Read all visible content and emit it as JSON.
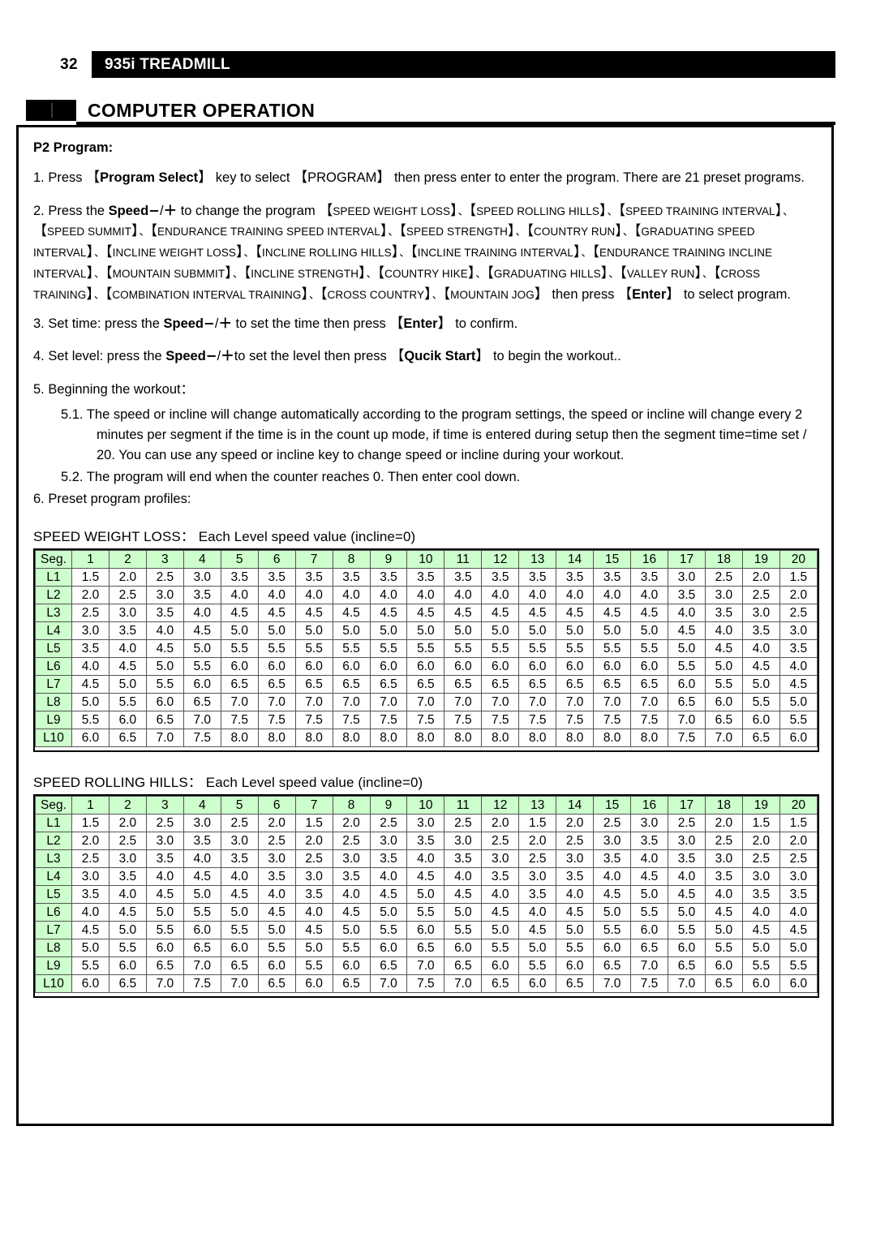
{
  "header": {
    "page_number": "32",
    "title": "935i TREADMILL"
  },
  "section": {
    "title": "COMPUTER OPERATION"
  },
  "content": {
    "lead": "P2 Program:",
    "step1": {
      "prefix": "1. Press",
      "key1": "Program Select",
      "mid1": "key to select",
      "key2": "PROGRAM",
      "tail": "then press enter to enter the program. There are 21 preset programs."
    },
    "step2": {
      "prefix": "2. Press the",
      "speed_label": "Speed",
      "minus": "−",
      "slash": "/",
      "plus": "＋",
      "mid": "to change the program",
      "programs": [
        "SPEED WEIGHT LOSS",
        "SPEED ROLLING HILLS",
        "SPEED TRAINING INTERVAL",
        "SPEED SUMMIT",
        "ENDURANCE TRAINING SPEED INTERVAL",
        "SPEED STRENGTH",
        "COUNTRY RUN",
        "GRADUATING SPEED INTERVAL",
        "INCLINE WEIGHT LOSS",
        "INCLINE ROLLING HILLS",
        "INCLINE TRAINING INTERVAL",
        "ENDURANCE TRAINING INCLINE INTERVAL",
        "MOUNTAIN SUBMMIT",
        "INCLINE STRENGTH",
        "COUNTRY HIKE",
        "GRADUATING HILLS",
        "VALLEY RUN",
        "CROSS TRAINING",
        "COMBINATION INTERVAL TRAINING",
        "CROSS COUNTRY",
        "MOUNTAIN JOG"
      ],
      "then_press": "then press",
      "enter_key": "Enter",
      "tail": "to select program."
    },
    "step3": {
      "prefix": "3. Set time: press the",
      "speed_label": "Speed",
      "mid": "to set the time then press",
      "enter_key": "Enter",
      "tail": "to confirm."
    },
    "step4": {
      "prefix": "4. Set level: press the",
      "speed_label": "Speed",
      "mid": "to set the level then press",
      "quick_key": "Qucik Start",
      "tail": "to begin the workout.."
    },
    "step5": {
      "heading": "5. Beginning the workout：",
      "sub1": "5.1. The speed or incline will change automatically according to the program settings, the speed or incline will change every 2 minutes per segment if the time is in the count up mode, if time is entered during setup then the segment time=time set / 20. You can use any speed or incline key to change speed or incline during your workout.",
      "sub2": "5.2. The program will end when the counter reaches 0. Then enter cool down."
    },
    "step6": "6. Preset program profiles:"
  },
  "tables": [
    {
      "caption": "SPEED WEIGHT LOSS： Each Level speed value (incline=0)",
      "corner": "Seg.",
      "segments": [
        "1",
        "2",
        "3",
        "4",
        "5",
        "6",
        "7",
        "8",
        "9",
        "10",
        "11",
        "12",
        "13",
        "14",
        "15",
        "16",
        "17",
        "18",
        "19",
        "20"
      ],
      "levels": [
        "L1",
        "L2",
        "L3",
        "L4",
        "L5",
        "L6",
        "L7",
        "L8",
        "L9",
        "L10"
      ],
      "rows": [
        [
          "1.5",
          "2.0",
          "2.5",
          "3.0",
          "3.5",
          "3.5",
          "3.5",
          "3.5",
          "3.5",
          "3.5",
          "3.5",
          "3.5",
          "3.5",
          "3.5",
          "3.5",
          "3.5",
          "3.0",
          "2.5",
          "2.0",
          "1.5"
        ],
        [
          "2.0",
          "2.5",
          "3.0",
          "3.5",
          "4.0",
          "4.0",
          "4.0",
          "4.0",
          "4.0",
          "4.0",
          "4.0",
          "4.0",
          "4.0",
          "4.0",
          "4.0",
          "4.0",
          "3.5",
          "3.0",
          "2.5",
          "2.0"
        ],
        [
          "2.5",
          "3.0",
          "3.5",
          "4.0",
          "4.5",
          "4.5",
          "4.5",
          "4.5",
          "4.5",
          "4.5",
          "4.5",
          "4.5",
          "4.5",
          "4.5",
          "4.5",
          "4.5",
          "4.0",
          "3.5",
          "3.0",
          "2.5"
        ],
        [
          "3.0",
          "3.5",
          "4.0",
          "4.5",
          "5.0",
          "5.0",
          "5.0",
          "5.0",
          "5.0",
          "5.0",
          "5.0",
          "5.0",
          "5.0",
          "5.0",
          "5.0",
          "5.0",
          "4.5",
          "4.0",
          "3.5",
          "3.0"
        ],
        [
          "3.5",
          "4.0",
          "4.5",
          "5.0",
          "5.5",
          "5.5",
          "5.5",
          "5.5",
          "5.5",
          "5.5",
          "5.5",
          "5.5",
          "5.5",
          "5.5",
          "5.5",
          "5.5",
          "5.0",
          "4.5",
          "4.0",
          "3.5"
        ],
        [
          "4.0",
          "4.5",
          "5.0",
          "5.5",
          "6.0",
          "6.0",
          "6.0",
          "6.0",
          "6.0",
          "6.0",
          "6.0",
          "6.0",
          "6.0",
          "6.0",
          "6.0",
          "6.0",
          "5.5",
          "5.0",
          "4.5",
          "4.0"
        ],
        [
          "4.5",
          "5.0",
          "5.5",
          "6.0",
          "6.5",
          "6.5",
          "6.5",
          "6.5",
          "6.5",
          "6.5",
          "6.5",
          "6.5",
          "6.5",
          "6.5",
          "6.5",
          "6.5",
          "6.0",
          "5.5",
          "5.0",
          "4.5"
        ],
        [
          "5.0",
          "5.5",
          "6.0",
          "6.5",
          "7.0",
          "7.0",
          "7.0",
          "7.0",
          "7.0",
          "7.0",
          "7.0",
          "7.0",
          "7.0",
          "7.0",
          "7.0",
          "7.0",
          "6.5",
          "6.0",
          "5.5",
          "5.0"
        ],
        [
          "5.5",
          "6.0",
          "6.5",
          "7.0",
          "7.5",
          "7.5",
          "7.5",
          "7.5",
          "7.5",
          "7.5",
          "7.5",
          "7.5",
          "7.5",
          "7.5",
          "7.5",
          "7.5",
          "7.0",
          "6.5",
          "6.0",
          "5.5"
        ],
        [
          "6.0",
          "6.5",
          "7.0",
          "7.5",
          "8.0",
          "8.0",
          "8.0",
          "8.0",
          "8.0",
          "8.0",
          "8.0",
          "8.0",
          "8.0",
          "8.0",
          "8.0",
          "8.0",
          "7.5",
          "7.0",
          "6.5",
          "6.0"
        ]
      ]
    },
    {
      "caption": "SPEED ROLLING HILLS： Each Level speed value (incline=0)",
      "corner": "Seg.",
      "segments": [
        "1",
        "2",
        "3",
        "4",
        "5",
        "6",
        "7",
        "8",
        "9",
        "10",
        "11",
        "12",
        "13",
        "14",
        "15",
        "16",
        "17",
        "18",
        "19",
        "20"
      ],
      "levels": [
        "L1",
        "L2",
        "L3",
        "L4",
        "L5",
        "L6",
        "L7",
        "L8",
        "L9",
        "L10"
      ],
      "rows": [
        [
          "1.5",
          "2.0",
          "2.5",
          "3.0",
          "2.5",
          "2.0",
          "1.5",
          "2.0",
          "2.5",
          "3.0",
          "2.5",
          "2.0",
          "1.5",
          "2.0",
          "2.5",
          "3.0",
          "2.5",
          "2.0",
          "1.5",
          "1.5"
        ],
        [
          "2.0",
          "2.5",
          "3.0",
          "3.5",
          "3.0",
          "2.5",
          "2.0",
          "2.5",
          "3.0",
          "3.5",
          "3.0",
          "2.5",
          "2.0",
          "2.5",
          "3.0",
          "3.5",
          "3.0",
          "2.5",
          "2.0",
          "2.0"
        ],
        [
          "2.5",
          "3.0",
          "3.5",
          "4.0",
          "3.5",
          "3.0",
          "2.5",
          "3.0",
          "3.5",
          "4.0",
          "3.5",
          "3.0",
          "2.5",
          "3.0",
          "3.5",
          "4.0",
          "3.5",
          "3.0",
          "2.5",
          "2.5"
        ],
        [
          "3.0",
          "3.5",
          "4.0",
          "4.5",
          "4.0",
          "3.5",
          "3.0",
          "3.5",
          "4.0",
          "4.5",
          "4.0",
          "3.5",
          "3.0",
          "3.5",
          "4.0",
          "4.5",
          "4.0",
          "3.5",
          "3.0",
          "3.0"
        ],
        [
          "3.5",
          "4.0",
          "4.5",
          "5.0",
          "4.5",
          "4.0",
          "3.5",
          "4.0",
          "4.5",
          "5.0",
          "4.5",
          "4.0",
          "3.5",
          "4.0",
          "4.5",
          "5.0",
          "4.5",
          "4.0",
          "3.5",
          "3.5"
        ],
        [
          "4.0",
          "4.5",
          "5.0",
          "5.5",
          "5.0",
          "4.5",
          "4.0",
          "4.5",
          "5.0",
          "5.5",
          "5.0",
          "4.5",
          "4.0",
          "4.5",
          "5.0",
          "5.5",
          "5.0",
          "4.5",
          "4.0",
          "4.0"
        ],
        [
          "4.5",
          "5.0",
          "5.5",
          "6.0",
          "5.5",
          "5.0",
          "4.5",
          "5.0",
          "5.5",
          "6.0",
          "5.5",
          "5.0",
          "4.5",
          "5.0",
          "5.5",
          "6.0",
          "5.5",
          "5.0",
          "4.5",
          "4.5"
        ],
        [
          "5.0",
          "5.5",
          "6.0",
          "6.5",
          "6.0",
          "5.5",
          "5.0",
          "5.5",
          "6.0",
          "6.5",
          "6.0",
          "5.5",
          "5.0",
          "5.5",
          "6.0",
          "6.5",
          "6.0",
          "5.5",
          "5.0",
          "5.0"
        ],
        [
          "5.5",
          "6.0",
          "6.5",
          "7.0",
          "6.5",
          "6.0",
          "5.5",
          "6.0",
          "6.5",
          "7.0",
          "6.5",
          "6.0",
          "5.5",
          "6.0",
          "6.5",
          "7.0",
          "6.5",
          "6.0",
          "5.5",
          "5.5"
        ],
        [
          "6.0",
          "6.5",
          "7.0",
          "7.5",
          "7.0",
          "6.5",
          "6.0",
          "6.5",
          "7.0",
          "7.5",
          "7.0",
          "6.5",
          "6.0",
          "6.5",
          "7.0",
          "7.5",
          "7.0",
          "6.5",
          "6.0",
          "6.0"
        ]
      ]
    }
  ],
  "colors": {
    "header_green": "#ccffcc",
    "bar_black": "#000000"
  }
}
